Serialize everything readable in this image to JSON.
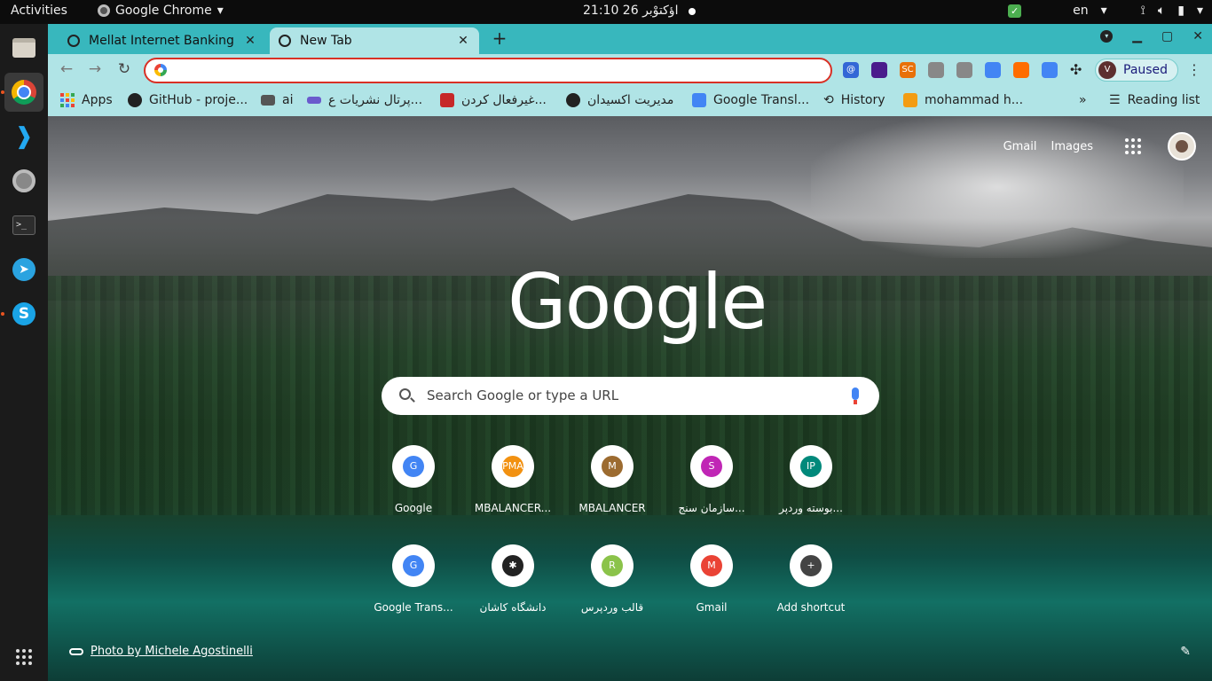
{
  "topbar": {
    "activities": "Activities",
    "app_name": "Google Chrome",
    "clock": "21:10  26 اؤکتوْبر",
    "lang": "en"
  },
  "tabs": [
    {
      "title": "Mellat Internet Banking"
    },
    {
      "title": "New Tab"
    }
  ],
  "omnibox": {
    "value": ""
  },
  "profile_button": {
    "label": "Paused",
    "avatar_letter": "V"
  },
  "extensions": [
    {
      "icon": "at-icon",
      "color": "#3367d6",
      "text": "@"
    },
    {
      "icon": "diamond-icon",
      "color": "#4a1c8c",
      "text": ""
    },
    {
      "icon": "sc-icon",
      "color": "#e8710a",
      "text": "SC"
    },
    {
      "icon": "camera-icon",
      "color": "#888888",
      "text": ""
    },
    {
      "icon": "spider-icon",
      "color": "#888888",
      "text": ""
    },
    {
      "icon": "translate-icon",
      "color": "#4285f4",
      "text": ""
    },
    {
      "icon": "swirl-icon",
      "color": "#ff6d00",
      "text": ""
    },
    {
      "icon": "tag-icon",
      "color": "#4285f4",
      "text": ""
    }
  ],
  "bookmarks": [
    {
      "label": "Apps"
    },
    {
      "label": "GitHub - proje..."
    },
    {
      "label": "ai"
    },
    {
      "label": "پرتال نشریات ع..."
    },
    {
      "label": "غیرفعال کردن..."
    },
    {
      "label": "مدیریت اکسیدان"
    },
    {
      "label": "Google Transl..."
    },
    {
      "label": "History"
    },
    {
      "label": "mohammad h..."
    }
  ],
  "reading_list": "Reading list",
  "ntp": {
    "gmail": "Gmail",
    "images": "Images",
    "logo": "Google",
    "search_placeholder": "Search Google or type a URL",
    "shortcuts": [
      {
        "name": "Google",
        "letter": "G",
        "color": "#4285f4"
      },
      {
        "name": "MBALANCER...",
        "letter": "PMA",
        "color": "#f29111"
      },
      {
        "name": "MBALANCER",
        "letter": "M",
        "color": "#9c6b30"
      },
      {
        "name": "سازمان سنج...",
        "letter": "S",
        "color": "#c026b5"
      },
      {
        "name": "بوسته وردپر...",
        "letter": "IP",
        "color": "#00897b"
      },
      {
        "name": "Google Trans...",
        "letter": "G",
        "color": "#4285f4"
      },
      {
        "name": "دانشگاه کاشان",
        "letter": "✱",
        "color": "#222222"
      },
      {
        "name": "قالب وردپرس",
        "letter": "R",
        "color": "#8bc34a"
      },
      {
        "name": "Gmail",
        "letter": "M",
        "color": "#ea4335"
      },
      {
        "name": "Add shortcut",
        "letter": "+",
        "color": "#444444"
      }
    ],
    "photo_credit": "Photo by Michele Agostinelli"
  }
}
